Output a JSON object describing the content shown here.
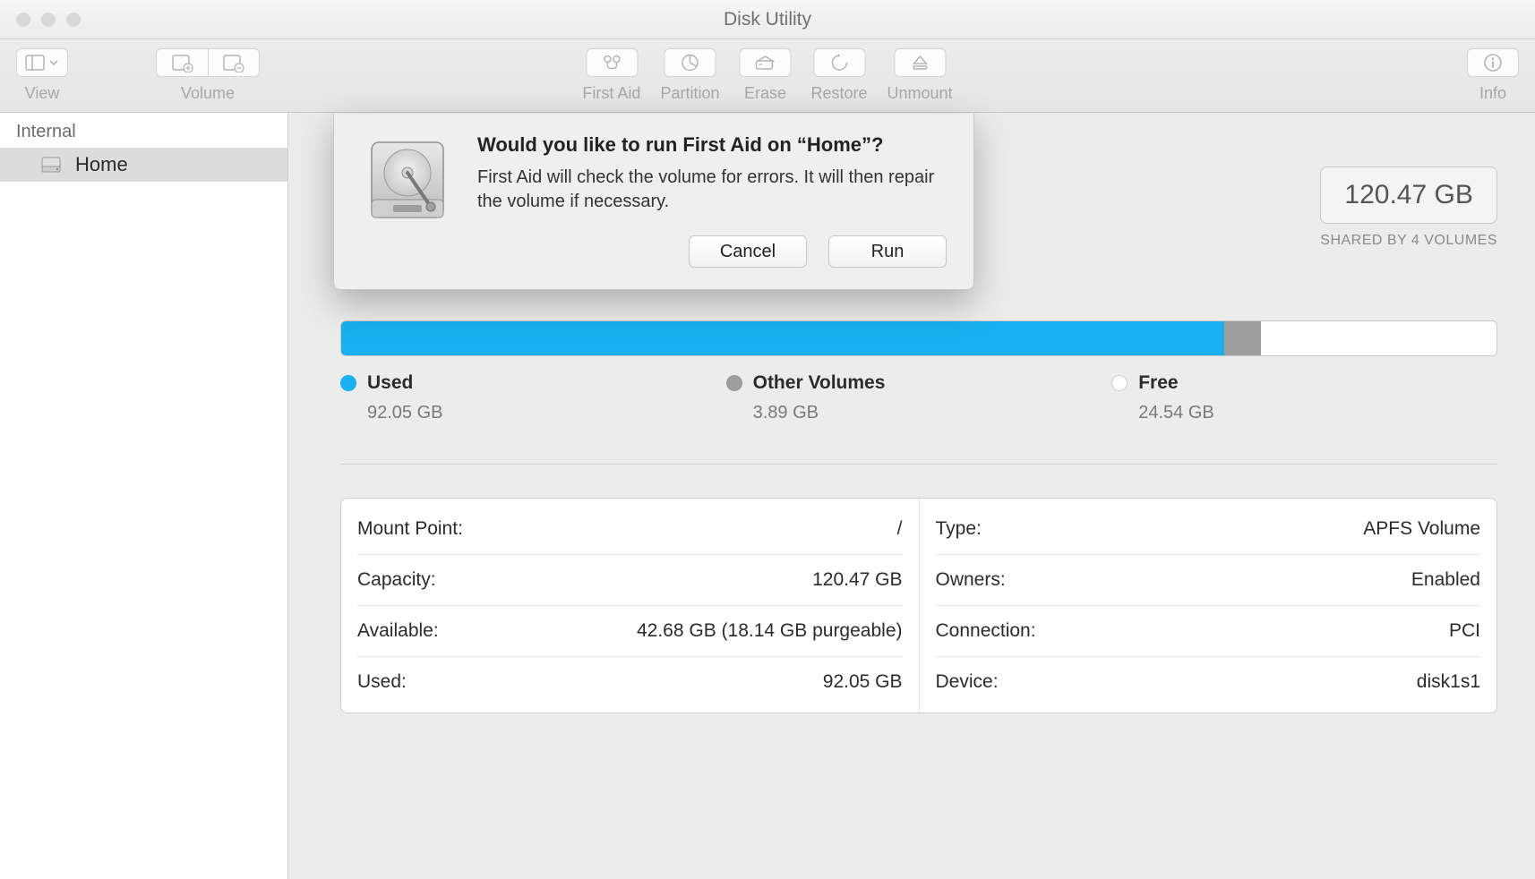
{
  "window": {
    "title": "Disk Utility"
  },
  "toolbar": {
    "view_label": "View",
    "volume_label": "Volume",
    "first_aid_label": "First Aid",
    "partition_label": "Partition",
    "erase_label": "Erase",
    "restore_label": "Restore",
    "unmount_label": "Unmount",
    "info_label": "Info"
  },
  "sidebar": {
    "header": "Internal",
    "items": [
      {
        "label": "Home"
      }
    ]
  },
  "capacity": {
    "value": "120.47 GB",
    "subtitle": "SHARED BY 4 VOLUMES"
  },
  "usage": {
    "used_label": "Used",
    "used_value": "92.05 GB",
    "other_label": "Other Volumes",
    "other_value": "3.89 GB",
    "free_label": "Free",
    "free_value": "24.54 GB"
  },
  "details": {
    "left": [
      {
        "label": "Mount Point:",
        "value": "/"
      },
      {
        "label": "Capacity:",
        "value": "120.47 GB"
      },
      {
        "label": "Available:",
        "value": "42.68 GB (18.14 GB purgeable)"
      },
      {
        "label": "Used:",
        "value": "92.05 GB"
      }
    ],
    "right": [
      {
        "label": "Type:",
        "value": "APFS Volume"
      },
      {
        "label": "Owners:",
        "value": "Enabled"
      },
      {
        "label": "Connection:",
        "value": "PCI"
      },
      {
        "label": "Device:",
        "value": "disk1s1"
      }
    ]
  },
  "modal": {
    "title": "Would you like to run First Aid on “Home”?",
    "text": "First Aid will check the volume for errors. It will then repair the volume if necessary.",
    "cancel": "Cancel",
    "run": "Run"
  }
}
